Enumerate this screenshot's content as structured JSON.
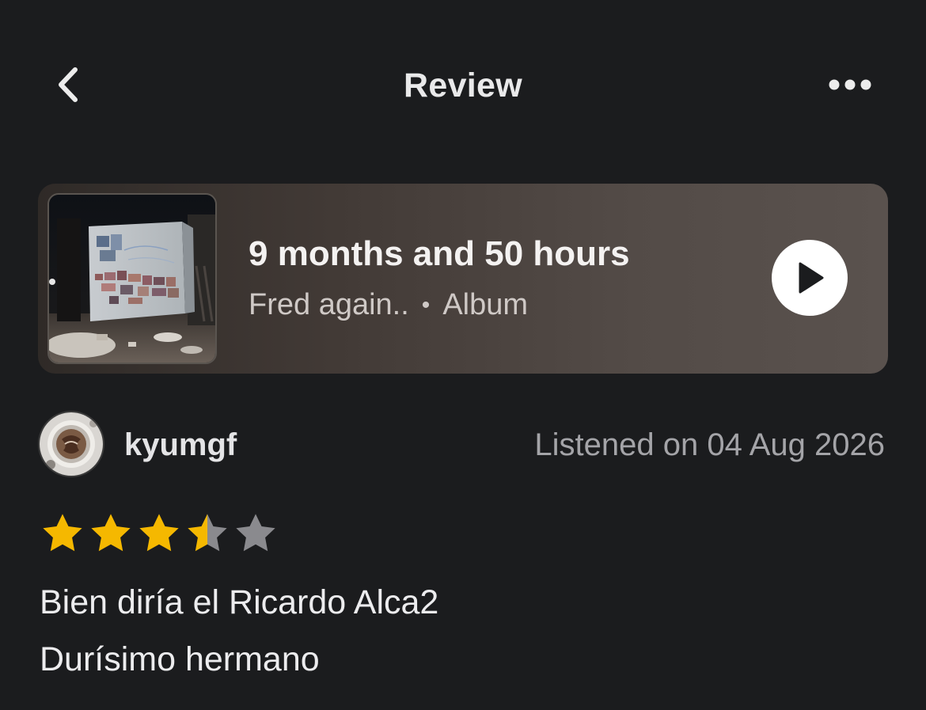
{
  "header": {
    "title": "Review",
    "back_icon": "chevron-left-icon",
    "more_icon": "ellipsis-horizontal-icon"
  },
  "album": {
    "title": "9 months and 50 hours",
    "artist": "Fred again..",
    "separator": "•",
    "type": "Album",
    "art": "album-cover-image",
    "play_icon": "play-icon"
  },
  "review": {
    "username": "kyumgf",
    "avatar": "avatar-image",
    "listened_label": "Listened on 04 Aug 2026",
    "rating": 3.5,
    "rating_max": 5,
    "text_lines": [
      "Bien diría el Ricardo Alca2",
      "Durísimo hermano"
    ]
  },
  "colors": {
    "background": "#1b1c1e",
    "card_start": "#2f2a27",
    "card_end": "#5a524e",
    "star_filled": "#f5b800",
    "star_empty": "#8a8a8e",
    "secondary_text": "#a4a4a8"
  }
}
